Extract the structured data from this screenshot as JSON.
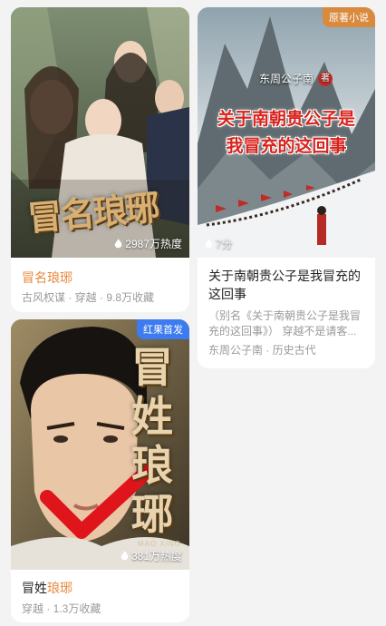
{
  "cards": [
    {
      "cover_title": "冒名琅琊",
      "heat": "2987万热度",
      "title": "冒名琅琊",
      "meta": "古风权谋 · 穿越 · 9.8万收藏"
    },
    {
      "tag": "原著小说",
      "cover_author": "东周公子南",
      "cover_author_badge": "著",
      "cover_title_line1": "关于南朝贵公子是",
      "cover_title_line2": "我冒充的这回事",
      "heat": "7分",
      "title": "关于南朝贵公子是我冒充的这回事",
      "desc": "（别名《关于南朝贵公子是我冒充的这回事》） 穿越不是请客...",
      "meta": "东周公子南 · 历史古代"
    },
    {
      "tag": "红果首发",
      "cover_title": "冒姓琅琊",
      "cover_subtitle": "MAO XING",
      "heat": "381万热度",
      "title_part1": "冒姓",
      "title_part2": "琅琊",
      "meta": "穿越 · 1.3万收藏"
    }
  ],
  "colors": {
    "highlight": "#e8873a",
    "tag_red": "#e23b2e",
    "tag_blue": "#3d7cf0"
  }
}
